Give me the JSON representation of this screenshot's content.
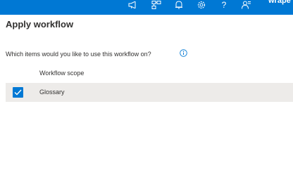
{
  "topbar": {
    "icons": [
      "megaphone-icon",
      "org-chart-icon",
      "bell-icon",
      "gear-icon",
      "help-icon",
      "people-icon"
    ],
    "help_glyph": "?",
    "user_text": "wrape",
    "colors": {
      "background": "#0078d4",
      "foreground": "#ffffff"
    }
  },
  "page": {
    "title": "Apply workflow",
    "question": "Which items would you like to use this workflow on?",
    "info_icon": "info-icon"
  },
  "table": {
    "column_header": "Workflow scope",
    "rows": [
      {
        "label": "Glossary",
        "checked": true
      }
    ]
  },
  "colors": {
    "accent": "#0078d4",
    "row_background": "#edebe9",
    "text": "#323130"
  }
}
